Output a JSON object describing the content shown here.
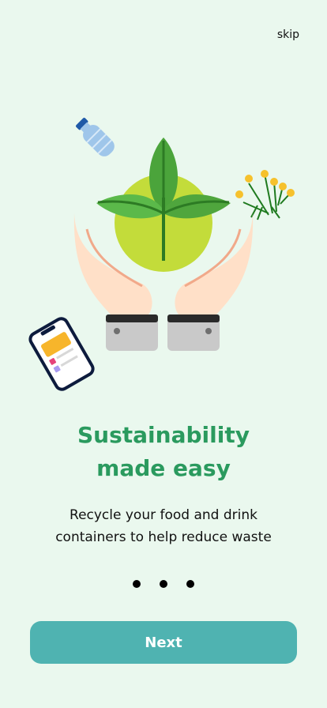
{
  "header": {
    "skip_label": "skip"
  },
  "content": {
    "title_line1": "Sustainability",
    "title_line2": "made easy",
    "subtitle_line1": "Recycle your food and drink",
    "subtitle_line2": "containers to help reduce waste"
  },
  "pager": {
    "total_pages": 3
  },
  "actions": {
    "next_label": "Next"
  },
  "colors": {
    "background": "#eaf8ee",
    "title": "#2a9a5e",
    "button": "#4fb3b1"
  },
  "icons": [
    "plastic-bottle-icon",
    "plant-icon",
    "hands-icon",
    "flowers-icon",
    "phone-icon"
  ]
}
